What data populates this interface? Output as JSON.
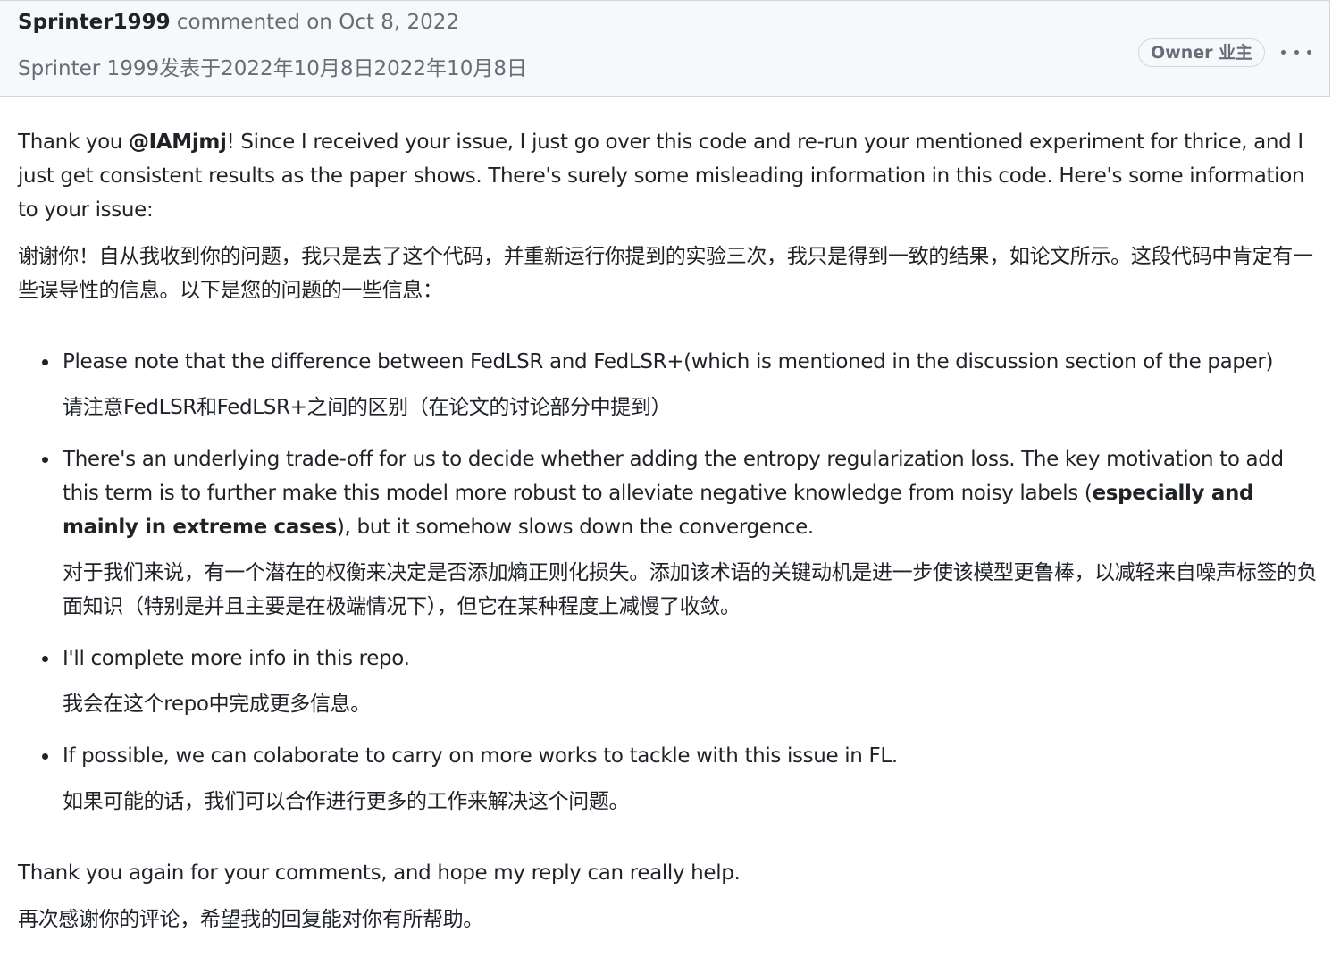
{
  "header": {
    "author": "Sprinter1999",
    "commented_text": "commented on Oct 8, 2022",
    "translated_line": "Sprinter 1999发表于2022年10月8日2022年10月8日",
    "owner_badge": "Owner 业主"
  },
  "body": {
    "intro": {
      "before_mention": "Thank you ",
      "mention": "@IAMjmj",
      "after_mention": "! Since I received your issue, I just go over this code and re-run your mentioned experiment for thrice, and I just get consistent results as the paper shows. There's surely some misleading information in this code. Here's some information to your issue:",
      "translation": "谢谢你！自从我收到你的问题，我只是去了这个代码，并重新运行你提到的实验三次，我只是得到一致的结果，如论文所示。这段代码中肯定有一些误导性的信息。以下是您的问题的一些信息："
    },
    "bullets": [
      {
        "text": "Please note that the difference between FedLSR and FedLSR+(which is mentioned in the discussion section of the paper)",
        "translation": "请注意FedLSR和FedLSR+之间的区别（在论文的讨论部分中提到）"
      },
      {
        "text_before": "There's an underlying trade-off for us to decide whether adding the entropy regularization loss. The key motivation to add this term is to further make this model more robust to alleviate negative knowledge from noisy labels (",
        "bold": "especially and mainly in extreme cases",
        "text_after": "), but it somehow slows down the convergence.",
        "translation": "对于我们来说，有一个潜在的权衡来决定是否添加熵正则化损失。添加该术语的关键动机是进一步使该模型更鲁棒，以减轻来自噪声标签的负面知识（特别是并且主要是在极端情况下），但它在某种程度上减慢了收敛。"
      },
      {
        "text": "I'll complete more info in this repo.",
        "translation": "我会在这个repo中完成更多信息。"
      },
      {
        "text": "If possible, we can colaborate to carry on more works to tackle with this issue in FL.",
        "translation": "如果可能的话，我们可以合作进行更多的工作来解决这个问题。"
      }
    ],
    "closing": {
      "text": "Thank you again for your comments, and hope my reply can really help.",
      "translation": "再次感谢你的评论，希望我的回复能对你有所帮助。"
    }
  },
  "icons": {
    "menu": "kebab-horizontal-icon"
  }
}
